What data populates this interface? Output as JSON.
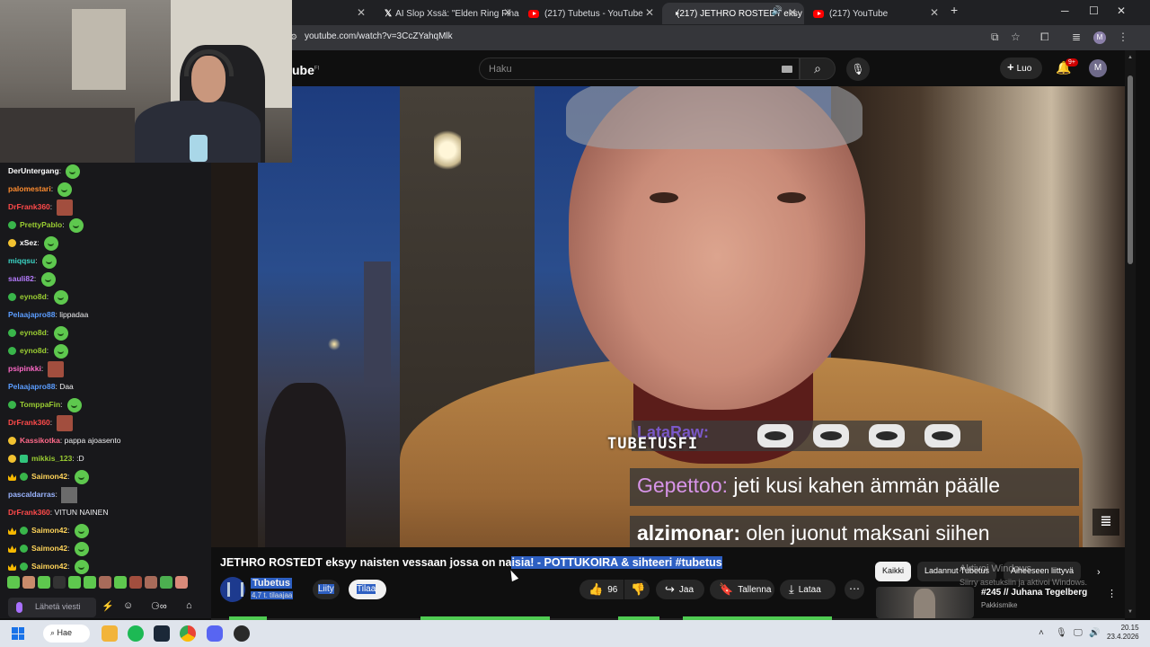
{
  "browser": {
    "tabs": [
      {
        "label": "AI Slop Xssä: \"Elden Ring Final",
        "type": "x"
      },
      {
        "label": "(217) Tubetus - YouTube",
        "type": "yt"
      },
      {
        "label": "(217) JETHRO ROSTEDT eksy",
        "type": "yt",
        "active": true
      },
      {
        "label": "(217) YouTube",
        "type": "yt"
      }
    ],
    "new_tab": "+",
    "url": "youtube.com/watch?v=3CcZYahqMlk",
    "profile_initial": "M"
  },
  "youtube": {
    "logo": "ube",
    "logo_region": "FI",
    "search_placeholder": "Haku",
    "create_label": "Luo",
    "notifications_badge": "9+",
    "avatar_initial": "M"
  },
  "video": {
    "overlay_tubetus": "TUBETUSFI",
    "overlay_strike_name": "LataRaw:",
    "overlay_line1_name": "Gepettoo:",
    "overlay_line1_text": " jeti kusi kahen ämmän päälle",
    "overlay_line2_name": "alzimonar:",
    "overlay_line2_text": " olen juonut maksani siihen",
    "title_plain": "JETHRO ROSTEDT eksyy naisten vessaan jossa on na",
    "title_selected": "isia! - POTTUKOIRA & sihteeri #tubetus",
    "channel_name": "Tubetus",
    "channel_subs": "4,7 t. tilaajaa",
    "join_label": "Liity",
    "subscribe_label": "Tilaa",
    "likes": "96",
    "share_label": "Jaa",
    "save_label": "Tallenna",
    "download_label": "Lataa"
  },
  "right_rail": {
    "chips": [
      "Kaikki",
      "Ladannut Tubetus",
      "Aiheeseen liittyvä"
    ],
    "related_title": "#245 // Juhana Tegelberg",
    "related_channel": "Pakkismike",
    "windows_watermark_1": "Aktivoi Windows",
    "windows_watermark_2": "Siirry asetuksiin ja aktivoi Windows."
  },
  "chat": {
    "messages": [
      {
        "badges": [],
        "name": "DerUntergang",
        "color": "#ffffff",
        "text": "",
        "emote": "green"
      },
      {
        "badges": [],
        "name": "palomestari",
        "color": "#ff8c2f",
        "text": "",
        "emote": "green"
      },
      {
        "badges": [],
        "name": "DrFrank360",
        "color": "#ff4a4a",
        "text": "",
        "emote": "red"
      },
      {
        "badges": [
          "g"
        ],
        "name": "PrettyPablo",
        "color": "#9acd32",
        "text": "",
        "emote": "green"
      },
      {
        "badges": [
          "y"
        ],
        "name": "xSez",
        "color": "#ffffff",
        "text": "",
        "emote": "green"
      },
      {
        "badges": [],
        "name": "miqqsu",
        "color": "#3bd6c6",
        "text": "",
        "emote": "green"
      },
      {
        "badges": [],
        "name": "sauli82",
        "color": "#b67cff",
        "text": "",
        "emote": "green"
      },
      {
        "badges": [
          "g"
        ],
        "name": "eyno8d",
        "color": "#9acd32",
        "text": "",
        "emote": "green"
      },
      {
        "badges": [],
        "name": "Pelaajapro88",
        "color": "#5b9dff",
        "text": "lippadaa",
        "emote": ""
      },
      {
        "badges": [
          "g"
        ],
        "name": "eyno8d",
        "color": "#9acd32",
        "text": "",
        "emote": "green"
      },
      {
        "badges": [
          "g"
        ],
        "name": "eyno8d",
        "color": "#9acd32",
        "text": "",
        "emote": "green"
      },
      {
        "badges": [],
        "name": "psipinkki",
        "color": "#ff69c8",
        "text": "",
        "emote": "red"
      },
      {
        "badges": [],
        "name": "Pelaajapro88",
        "color": "#5b9dff",
        "text": "Daa",
        "emote": ""
      },
      {
        "badges": [
          "g"
        ],
        "name": "TomppaFin",
        "color": "#9acd32",
        "text": "",
        "emote": "green"
      },
      {
        "badges": [],
        "name": "DrFrank360",
        "color": "#ff4a4a",
        "text": "",
        "emote": "red"
      },
      {
        "badges": [
          "y"
        ],
        "name": "Kassikotka",
        "color": "#ff6a8a",
        "text": "pappa ajoasento",
        "emote": ""
      },
      {
        "badges": [
          "y",
          "gr"
        ],
        "name": "mikkis_123",
        "color": "#9acd32",
        "text": ":D",
        "emote": ""
      },
      {
        "badges": [
          "c",
          "g"
        ],
        "name": "Saimon42",
        "color": "#ffd45a",
        "text": "",
        "emote": "green"
      },
      {
        "badges": [],
        "name": "pascaldarras",
        "color": "#9ab4ff",
        "text": "",
        "emote": "gray"
      },
      {
        "badges": [],
        "name": "DrFrank360",
        "color": "#ff4a4a",
        "text": "VITUN NAINEN",
        "emote": ""
      },
      {
        "badges": [
          "c",
          "g"
        ],
        "name": "Saimon42",
        "color": "#ffd45a",
        "text": "",
        "emote": "green"
      },
      {
        "badges": [
          "c",
          "g"
        ],
        "name": "Saimon42",
        "color": "#ffd45a",
        "text": "",
        "emote": "green"
      },
      {
        "badges": [
          "c",
          "g"
        ],
        "name": "Saimon42",
        "color": "#ffd45a",
        "text": "",
        "emote": "green"
      }
    ],
    "input_placeholder": "Lähetä viesti"
  },
  "taskbar": {
    "search_label": "Hae",
    "time": "20.15",
    "date": "23.4.2026"
  }
}
